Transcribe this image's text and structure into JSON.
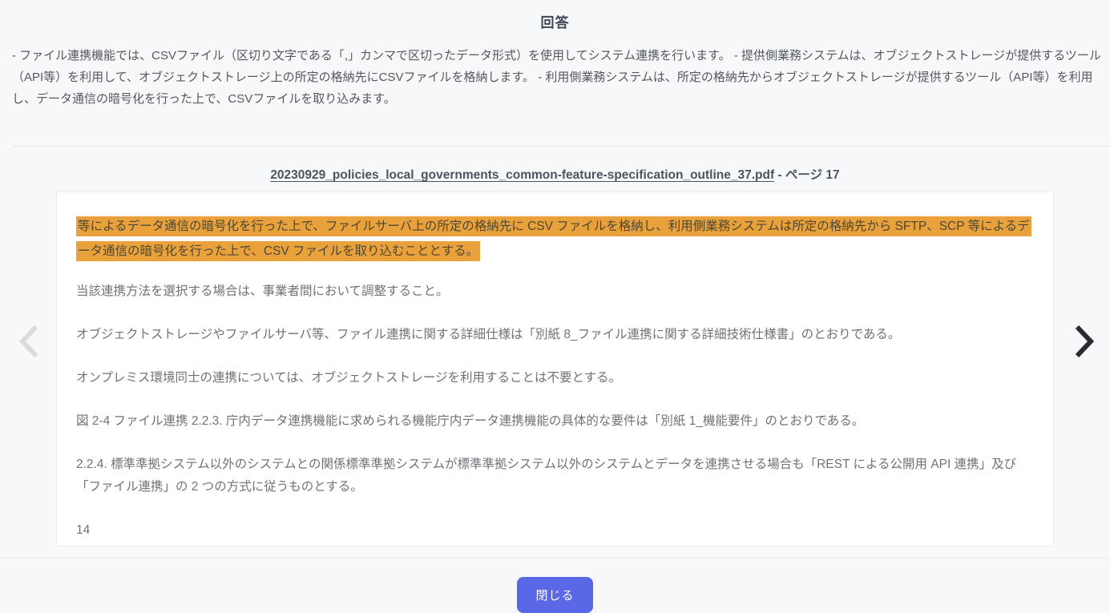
{
  "modal": {
    "title": "回答",
    "answer_text": "- ファイル連携機能では、CSVファイル（区切り文字である「,」カンマで区切ったデータ形式）を使用してシステム連携を行います。 - 提供側業務システムは、オブジェクトストレージが提供するツール（API等）を利用して、オブジェクトストレージ上の所定の格納先にCSVファイルを格納します。 - 利用側業務システムは、所定の格納先からオブジェクトストレージが提供するツール（API等）を利用し、データ通信の暗号化を行った上で、CSVファイルを取り込みます。",
    "source": {
      "filename": "20230929_policies_local_governments_common-feature-specification_outline_37.pdf",
      "page_suffix": " - ページ 17"
    },
    "document": {
      "highlighted_text": "等によるデータ通信の暗号化を行った上で、ファイルサーバ上の所定の格納先に CSV ファイルを格納し、利用側業務システムは所定の格納先から SFTP、SCP 等によるデータ通信の暗号化を行った上で、CSV ファイルを取り込むこととする。",
      "paragraphs": [
        "当該連携方法を選択する場合は、事業者間において調整すること。",
        "オブジェクトストレージやファイルサーバ等、ファイル連携に関する詳細仕様は「別紙 8_ファイル連携に関する詳細技術仕様書」のとおりである。",
        "オンプレミス環境同士の連携については、オブジェクトストレージを利用することは不要とする。",
        "図 2-4 ファイル連携 2.2.3. 庁内データ連携機能に求められる機能庁内データ連携機能の具体的な要件は「別紙 1_機能要件」のとおりである。",
        "2.2.4. 標準準拠システム以外のシステムとの関係標準準拠システムが標準準拠システム以外のシステムとデータを連携させる場合も「REST による公開用 API 連携」及び「ファイル連携」の 2 つの方式に従うものとする。",
        "14"
      ]
    },
    "close_button_label": "閉じる"
  },
  "colors": {
    "highlight": "#e9a23b",
    "button": "#5a67e6",
    "arrow_inactive": "#d9dbde",
    "arrow_active": "#282c31"
  }
}
